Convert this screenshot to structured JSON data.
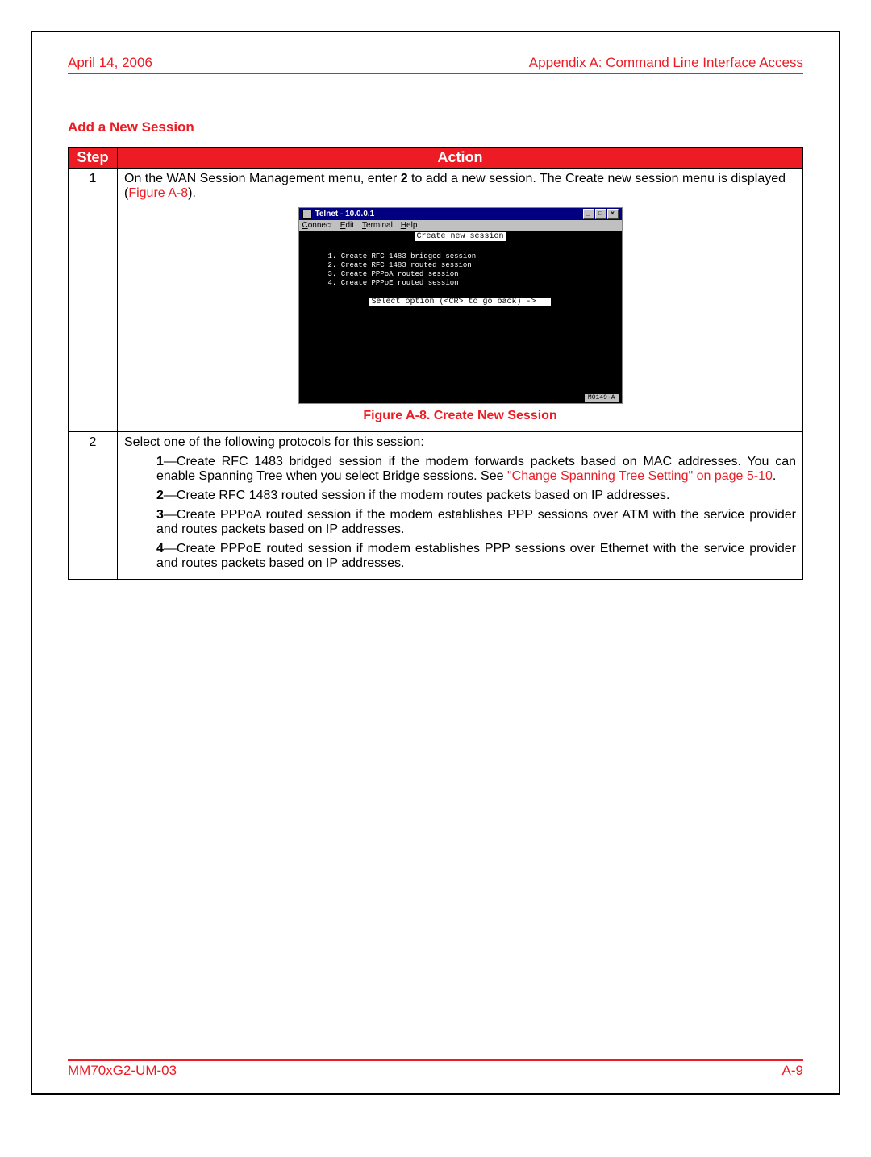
{
  "header": {
    "date": "April 14, 2006",
    "appendix": "Appendix A: Command Line Interface Access"
  },
  "section_title": "Add a New Session",
  "table": {
    "head_step": "Step",
    "head_action": "Action",
    "row1": {
      "num": "1",
      "text_a": "On the WAN Session Management menu, enter ",
      "bold2": "2",
      "text_b": " to add a new session. The Create new session menu is displayed (",
      "link": "Figure A-8",
      "text_c": ").",
      "figure_caption": "Figure A-8. Create New Session"
    },
    "telnet": {
      "title": "Telnet - 10.0.0.1",
      "menu": {
        "connect": "Connect",
        "edit": "Edit",
        "terminal": "Terminal",
        "help": "Help"
      },
      "heading": "Create new session",
      "opt1": "1. Create RFC 1483 bridged session",
      "opt2": "2. Create RFC 1483 routed session",
      "opt3": "3. Create PPPoA routed session",
      "opt4": "4. Create PPPoE routed session",
      "prompt": "Select option (<CR> to go back) ->",
      "tag": "MO149-A"
    },
    "row2": {
      "num": "2",
      "intro": "Select one of the following protocols for this session:",
      "p1a": "1",
      "p1b": "—Create RFC 1483 bridged session if the modem forwards packets based on MAC addresses. You can enable Spanning Tree when you select Bridge sessions. See ",
      "p1link": "\"Change Spanning Tree Setting\" on page 5-10",
      "p1c": ".",
      "p2a": "2",
      "p2b": "—Create RFC 1483 routed session if the modem routes packets based on IP addresses.",
      "p3a": "3",
      "p3b": "—Create PPPoA routed session if the modem establishes PPP sessions over ATM with the service provider and routes packets based on IP addresses.",
      "p4a": "4",
      "p4b": "—Create PPPoE routed session if modem establishes PPP sessions over Ethernet with the service provider and routes packets based on IP addresses."
    }
  },
  "footer": {
    "left": "MM70xG2-UM-03",
    "right": "A-9"
  }
}
